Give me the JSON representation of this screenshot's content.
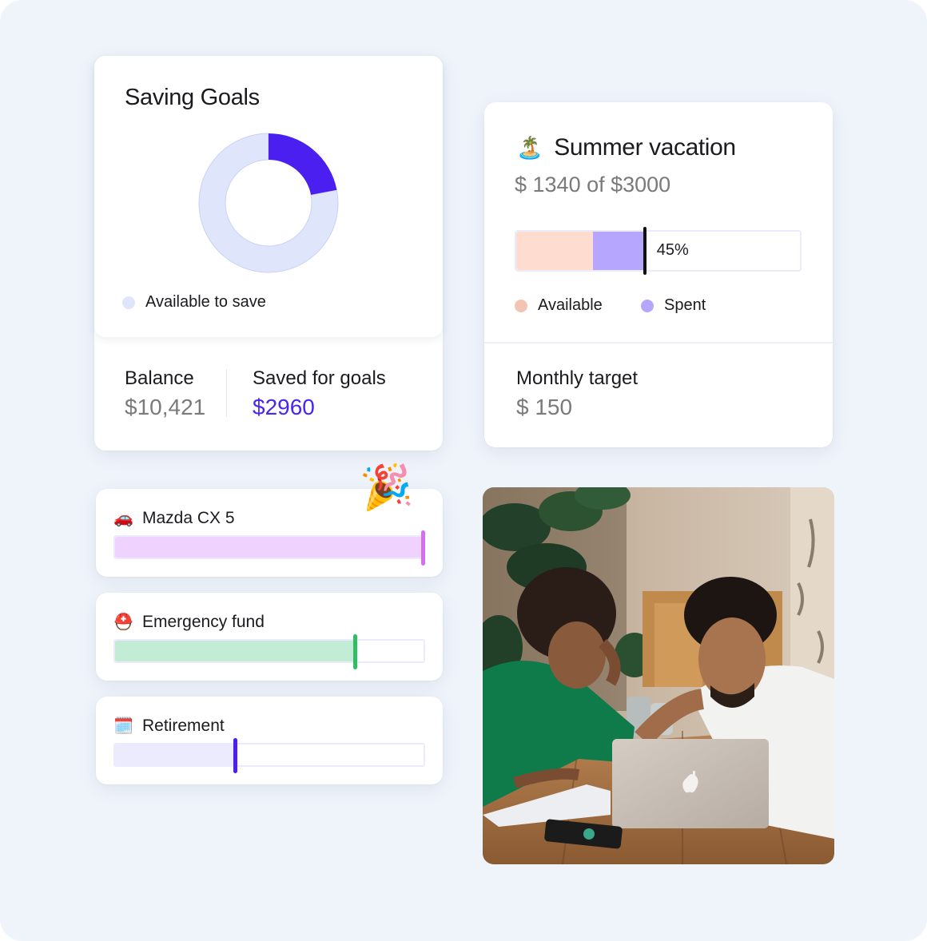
{
  "saving_goals": {
    "title": "Saving Goals",
    "legend_label": "Available to save",
    "balance_label": "Balance",
    "balance_value": "$10,421",
    "saved_label": "Saved for goals",
    "saved_value": "$2960"
  },
  "chart_data": {
    "type": "pie",
    "title": "Saving Goals",
    "donut": true,
    "slices": [
      {
        "name": "Saved for goals",
        "value": 22,
        "color": "#4a1ff0"
      },
      {
        "name": "Available to save",
        "value": 78,
        "color": "#dfe5fb"
      }
    ],
    "legend": [
      "Available to save"
    ],
    "legend_placement": "bottom-left"
  },
  "vacation": {
    "emoji": "🏝️",
    "title": "Summer vacation",
    "amount_text": "$ 1340 of  $3000",
    "progress_percent_label": "45%",
    "progress_percent": 45,
    "available_percent": 27,
    "spent_percent": 18,
    "legend_available": "Available",
    "legend_spent": "Spent",
    "monthly_target_label": "Monthly target",
    "monthly_target_value": "$ 150",
    "colors": {
      "available": "#fedcd0",
      "spent": "#b6a6fd",
      "available_dot": "#f2c4b3",
      "spent_dot": "#b6a6fd"
    }
  },
  "goals": [
    {
      "emoji": "🚗",
      "icon": "car-icon",
      "name": "Mazda CX 5",
      "progress_percent": 100,
      "fill_color": "#f0d2fe",
      "marker_color": "#d56ef3",
      "celebrate_emoji": "🎉"
    },
    {
      "emoji": "⛑️",
      "icon": "rescue-helmet-icon",
      "name": "Emergency fund",
      "progress_percent": 78,
      "fill_color": "#c2ecd4",
      "marker_color": "#2fbe62"
    },
    {
      "emoji": "🗓️",
      "icon": "calendar-icon",
      "name": "Retirement",
      "progress_percent": 39,
      "fill_color": "#ebebfd",
      "marker_color": "#4a1ff0"
    }
  ],
  "legend_colors": {
    "available_to_save": "#dfe5fb"
  },
  "photo": {
    "alt": "Couple smiling at a laptop at a wooden table"
  }
}
